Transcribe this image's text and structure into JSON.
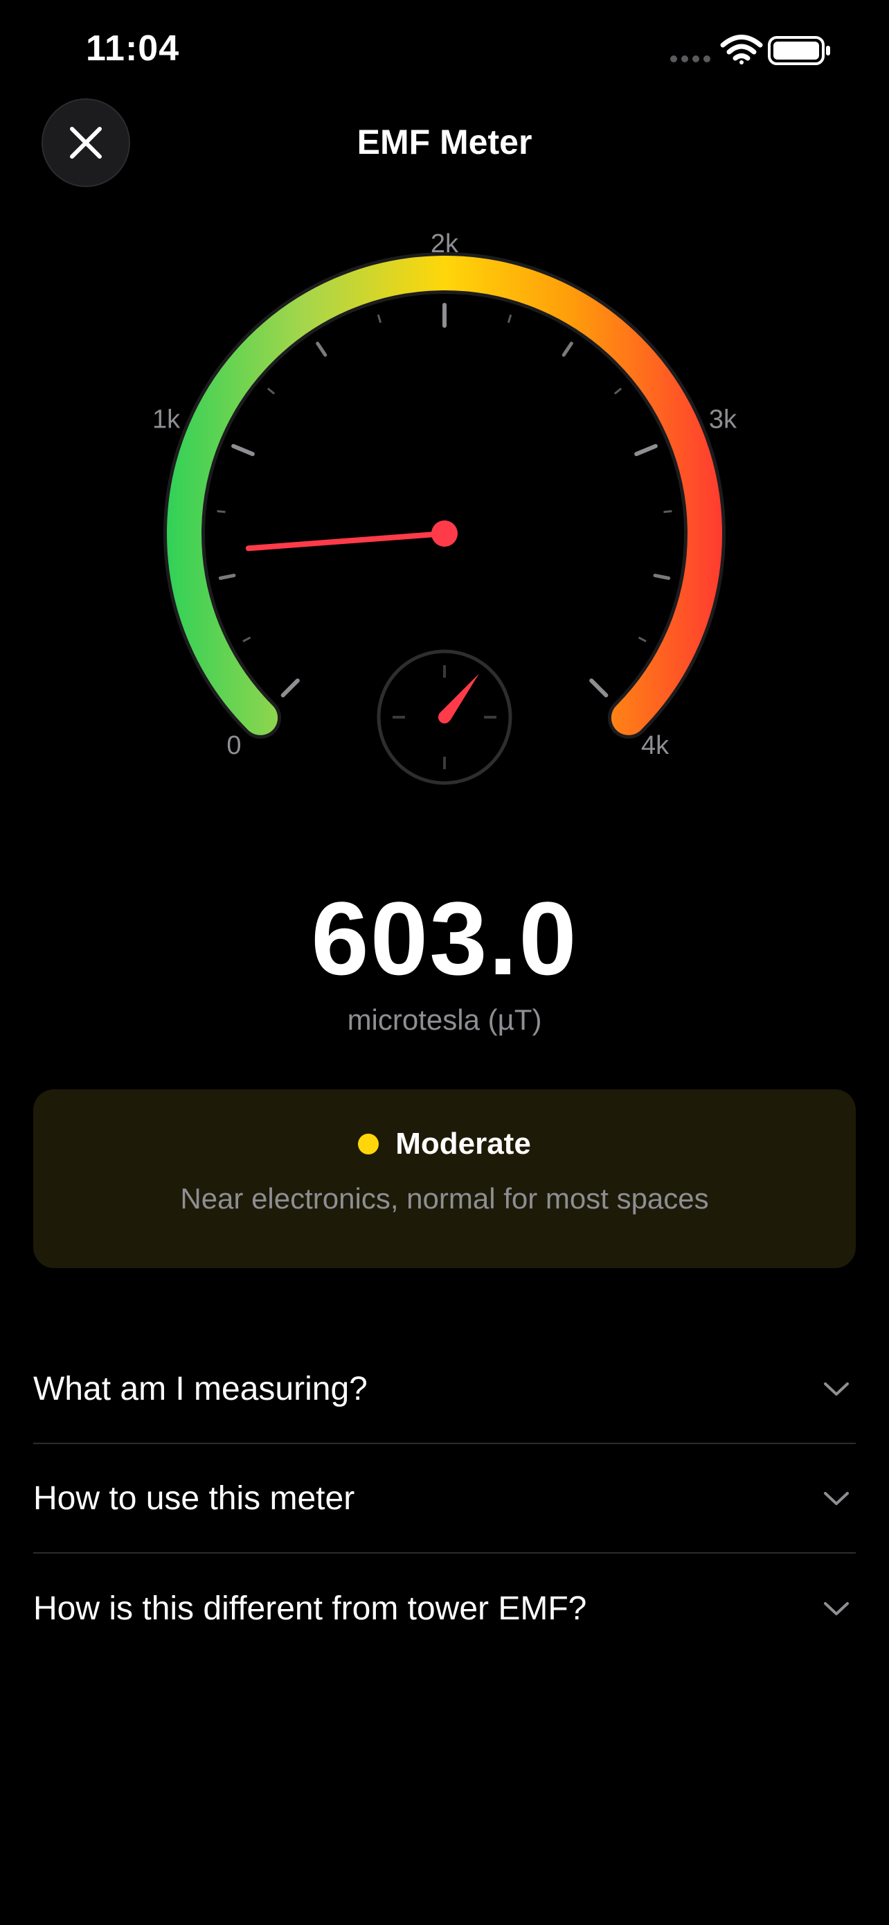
{
  "status_bar": {
    "time": "11:04",
    "icons": [
      "cellular-dots-icon",
      "wifi-icon",
      "battery-full-icon"
    ]
  },
  "header": {
    "title": "EMF Meter",
    "close_icon": "close-icon"
  },
  "gauge": {
    "min": 0,
    "max": 4000,
    "value": 603.0,
    "labels": [
      "0",
      "1k",
      "2k",
      "3k",
      "4k"
    ],
    "colors": [
      "#30d158",
      "#a6d64b",
      "#ffd60a",
      "#ff9f0a",
      "#ff3b30"
    ],
    "needle_color": "#ff3b4a"
  },
  "reading": {
    "value": "603.0",
    "unit": "microtesla (µT)"
  },
  "level": {
    "label": "Moderate",
    "description": "Near electronics, normal for most spaces",
    "dot_color": "#ffd60a"
  },
  "faq": [
    {
      "question": "What am I measuring?"
    },
    {
      "question": "How to use this meter"
    },
    {
      "question": "How is this different from tower EMF?"
    }
  ]
}
